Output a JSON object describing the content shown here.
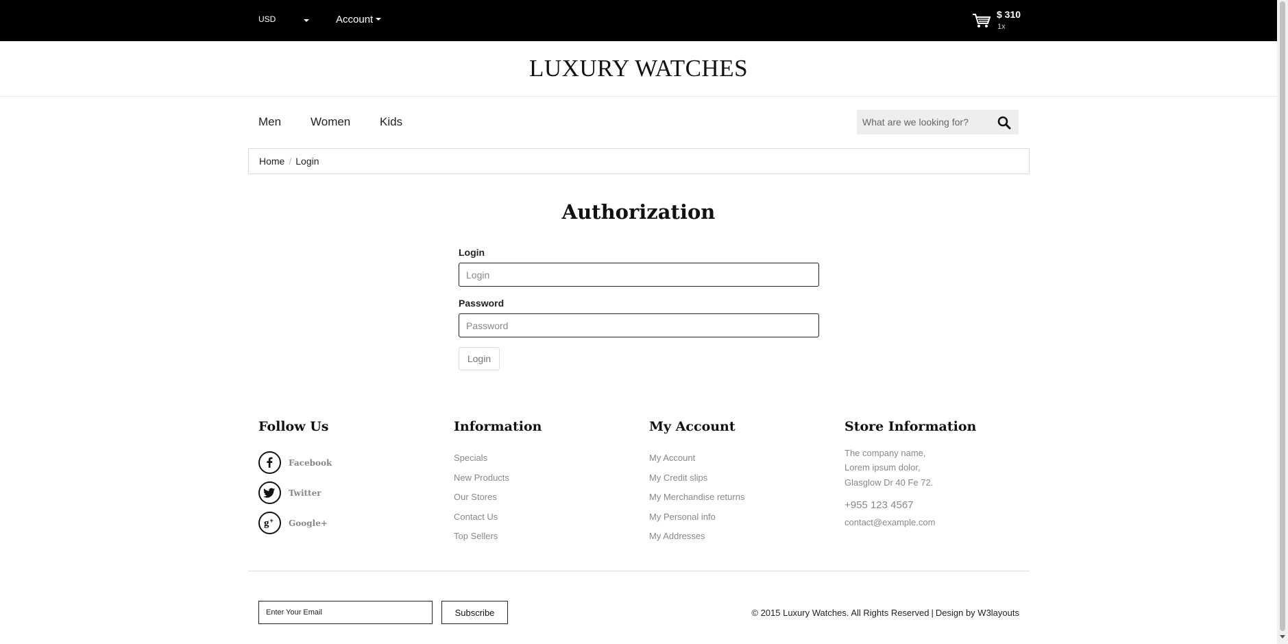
{
  "topbar": {
    "currency": "USD",
    "account_label": "Account",
    "cart_total": "$ 310",
    "cart_count": "1x"
  },
  "logo": "LUXURY WATCHES",
  "nav": [
    "Men",
    "Women",
    "Kids"
  ],
  "search": {
    "placeholder": "What are we looking for?"
  },
  "breadcrumb": {
    "home": "Home",
    "current": "Login"
  },
  "auth": {
    "title": "Authorization",
    "login_label": "Login",
    "login_placeholder": "Login",
    "password_label": "Password",
    "password_placeholder": "Password",
    "submit": "Login"
  },
  "footer": {
    "follow": {
      "title": "Follow Us",
      "items": [
        "Facebook",
        "Twitter",
        "Google+"
      ]
    },
    "information": {
      "title": "Information",
      "links": [
        "Specials",
        "New Products",
        "Our Stores",
        "Contact Us",
        "Top Sellers"
      ]
    },
    "account": {
      "title": "My Account",
      "links": [
        "My Account",
        "My Credit slips",
        "My Merchandise returns",
        "My Personal info",
        "My Addresses"
      ]
    },
    "store": {
      "title": "Store Information",
      "address": [
        "The company name,",
        "Lorem ipsum dolor,",
        "Glasglow Dr 40 Fe 72."
      ],
      "phone": "+955 123 4567",
      "email": "contact@example.com"
    },
    "newsletter": {
      "placeholder": "Enter Your Email",
      "button": "Subscribe"
    },
    "copyright": "© 2015 Luxury Watches. All Rights Reserved",
    "separator": "|",
    "design_credit": "Design by W3layouts"
  }
}
